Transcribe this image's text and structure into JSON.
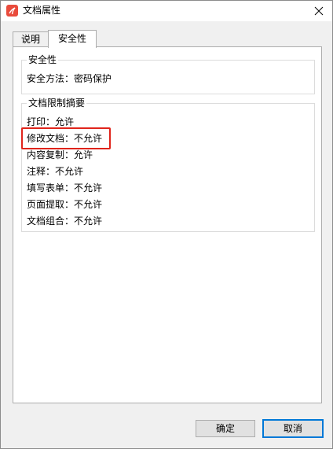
{
  "window": {
    "title": "文档属性"
  },
  "tabs": [
    {
      "label": "说明"
    },
    {
      "label": "安全性"
    }
  ],
  "security_group": {
    "title": "安全性",
    "method_row": "安全方法：密码保护"
  },
  "restrictions_group": {
    "title": "文档限制摘要",
    "rows": [
      "打印：允许",
      "修改文档：不允许",
      "内容复制：允许",
      "注释：不允许",
      "填写表单：不允许",
      "页面提取：不允许",
      "文档组合：不允许"
    ]
  },
  "buttons": {
    "ok": "确定",
    "cancel": "取消"
  },
  "colors": {
    "highlight": "#e0241b",
    "app_icon": "#e94b3c",
    "focus_border": "#0078d7"
  },
  "icons": [
    "app-pdf-icon",
    "close-icon"
  ]
}
